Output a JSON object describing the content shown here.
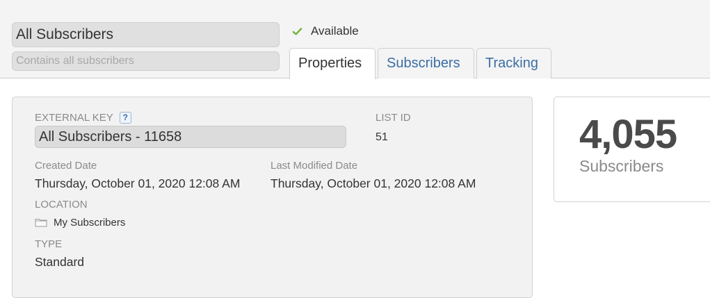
{
  "header": {
    "title": "All Subscribers",
    "description_placeholder": "Contains all subscribers",
    "status_label": "Available",
    "status_color": "#6fb33f",
    "tabs": [
      {
        "label": "Properties",
        "active": true
      },
      {
        "label": "Subscribers",
        "active": false
      },
      {
        "label": "Tracking",
        "active": false
      }
    ]
  },
  "properties": {
    "external_key_label": "EXTERNAL KEY",
    "help_icon_text": "?",
    "external_key_value": "All Subscribers - 11658",
    "list_id_label": "LIST ID",
    "list_id_value": "51",
    "created_label": "Created Date",
    "created_value": "Thursday, October 01, 2020 12:08 AM",
    "modified_label": "Last Modified Date",
    "modified_value": "Thursday, October 01, 2020 12:08 AM",
    "location_label": "LOCATION",
    "location_icon": "folder-icon",
    "location_value": "My Subscribers",
    "type_label": "TYPE",
    "type_value": "Standard"
  },
  "summary": {
    "count": "4,055",
    "count_label": "Subscribers"
  }
}
